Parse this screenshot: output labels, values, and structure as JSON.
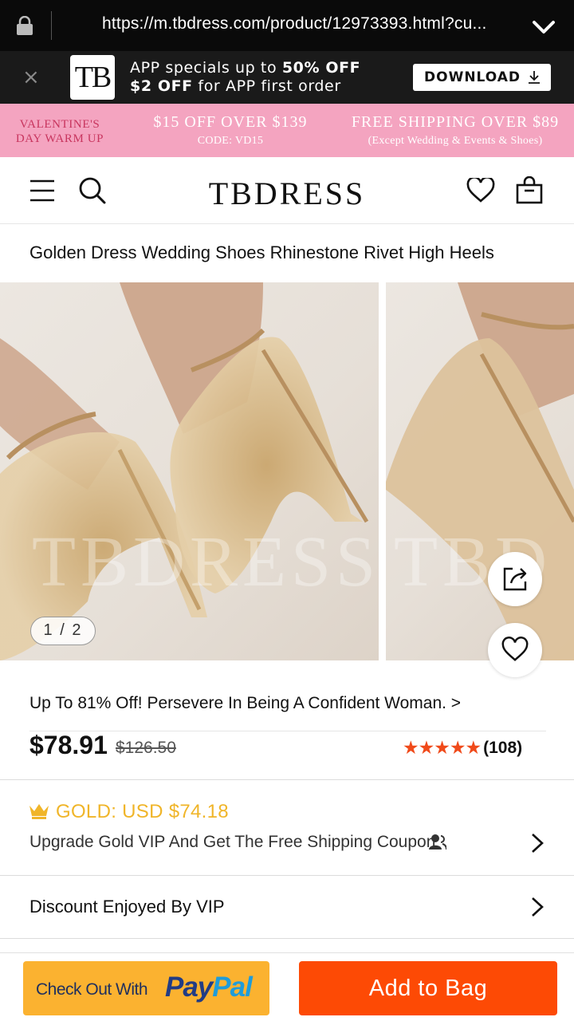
{
  "browser": {
    "url": "https://m.tbdress.com/product/12973393.html?cu..."
  },
  "app_banner": {
    "close": "×",
    "logo": "TB",
    "line1_prefix": "APP specials up to ",
    "line1_bold": "50% OFF",
    "line2_bold": "$2 OFF",
    "line2_suffix": " for APP first order",
    "download_label": "DOWNLOAD"
  },
  "promo_strip": {
    "left_line1": "VALENTINE'S",
    "left_line2": "DAY WARM UP",
    "mid_big": "$15 OFF OVER $139",
    "mid_small": "CODE: VD15",
    "right_big": "FREE SHIPPING OVER $89",
    "right_small": "(Except Wedding & Events & Shoes)"
  },
  "header": {
    "brand": "TBDRESS"
  },
  "product": {
    "title": "Golden Dress Wedding Shoes Rhinestone Rivet High Heels",
    "image_counter": "1 / 2",
    "promo_link": "Up To 81% Off! Persevere In Being A Confident Woman.  >",
    "price": "$78.91",
    "old_price": "$126.50",
    "stars": "★★★★★",
    "rating": 5,
    "review_count": "(108)"
  },
  "gold": {
    "label": "GOLD: USD $74.18",
    "upgrade_text": "Upgrade Gold VIP And Get The Free Shipping Coupon"
  },
  "discount": {
    "label": "Discount Enjoyed By VIP"
  },
  "bottom": {
    "paypal_prefix": "Check Out With",
    "paypal_a": "Pay",
    "paypal_b": "Pal",
    "add_to_bag": "Add to Bag"
  },
  "colors": {
    "accent": "#fd4a05",
    "gold": "#f0b529",
    "star": "#f04a1a",
    "promo_pink": "#f4a4c0",
    "paypal_yellow": "#fbb230"
  },
  "icons": [
    "lock-icon",
    "chevron-down-icon",
    "close-icon",
    "download-icon",
    "menu-icon",
    "search-icon",
    "heart-icon",
    "bag-icon",
    "share-icon",
    "favorite-icon",
    "crown-icon",
    "vip-user-icon",
    "chevron-right-icon"
  ]
}
